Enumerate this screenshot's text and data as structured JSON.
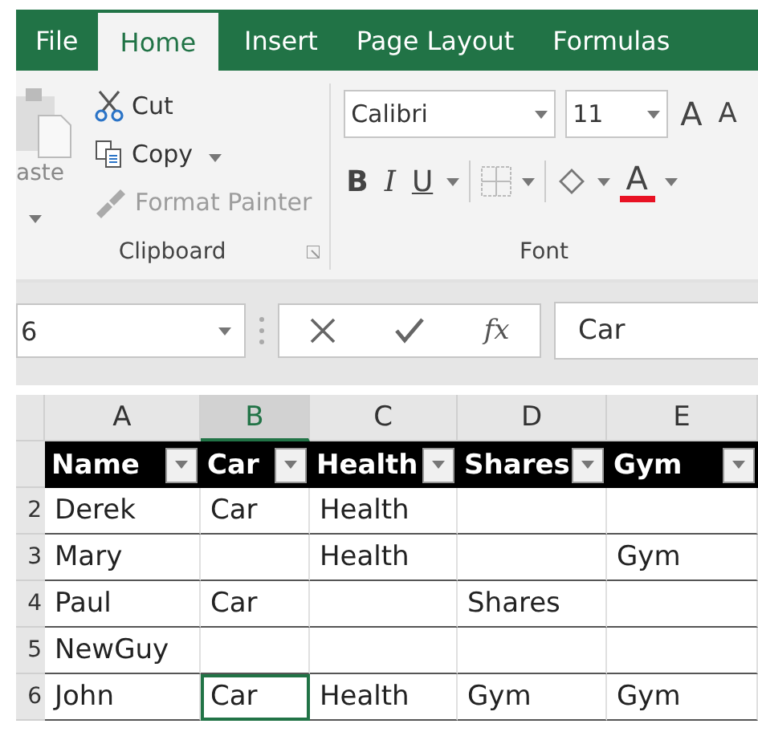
{
  "tabs": [
    {
      "label": "File",
      "selected": false
    },
    {
      "label": "Home",
      "selected": true
    },
    {
      "label": "Insert",
      "selected": false
    },
    {
      "label": "Page Layout",
      "selected": false
    },
    {
      "label": "Formulas",
      "selected": false
    }
  ],
  "clipboard": {
    "paste_label": "aste",
    "group_label": "Clipboard",
    "items": [
      {
        "kind": "cut",
        "label": "Cut",
        "disabled": false,
        "dropdown": false
      },
      {
        "kind": "copy",
        "label": "Copy",
        "disabled": false,
        "dropdown": true
      },
      {
        "kind": "painter",
        "label": "Format Painter",
        "disabled": true,
        "dropdown": false
      }
    ]
  },
  "font": {
    "family": "Calibri",
    "size": "11",
    "grow": "A",
    "shrink": "A",
    "bold": "B",
    "italic": "I",
    "underline": "U",
    "color_letter": "A",
    "color": "#e81123",
    "group_label": "Font"
  },
  "formula_bar": {
    "name_box": "6",
    "fx": "fx",
    "value": "Car"
  },
  "sheet": {
    "columns": [
      {
        "label": "A",
        "selected": false
      },
      {
        "label": "B",
        "selected": true
      },
      {
        "label": "C",
        "selected": false
      },
      {
        "label": "D",
        "selected": false
      },
      {
        "label": "E",
        "selected": false
      }
    ],
    "header": [
      "Name",
      "Car",
      "Health",
      "Shares",
      "Gym"
    ],
    "rows": [
      {
        "number": "2",
        "cells": [
          {
            "text": "Derek",
            "selected": false
          },
          {
            "text": "Car",
            "selected": false
          },
          {
            "text": "Health",
            "selected": false
          },
          {
            "selected": false
          },
          {
            "selected": false
          }
        ]
      },
      {
        "number": "3",
        "cells": [
          {
            "text": "Mary",
            "selected": false
          },
          {
            "selected": false
          },
          {
            "text": "Health",
            "selected": false
          },
          {
            "selected": false
          },
          {
            "text": "Gym",
            "selected": false
          }
        ]
      },
      {
        "number": "4",
        "cells": [
          {
            "text": "Paul",
            "selected": false
          },
          {
            "text": "Car",
            "selected": false
          },
          {
            "selected": false
          },
          {
            "text": "Shares",
            "selected": false
          },
          {
            "selected": false
          }
        ]
      },
      {
        "number": "5",
        "cells": [
          {
            "text": "NewGuy",
            "selected": false
          },
          {
            "selected": false
          },
          {
            "selected": false
          },
          {
            "selected": false
          },
          {
            "selected": false
          }
        ]
      },
      {
        "number": "6",
        "cells": [
          {
            "text": "John",
            "selected": false
          },
          {
            "text": "Car",
            "selected": true
          },
          {
            "text": "Health",
            "selected": false
          },
          {
            "text": "Gym",
            "selected": false
          },
          {
            "text": "Gym",
            "selected": false
          }
        ]
      }
    ]
  }
}
